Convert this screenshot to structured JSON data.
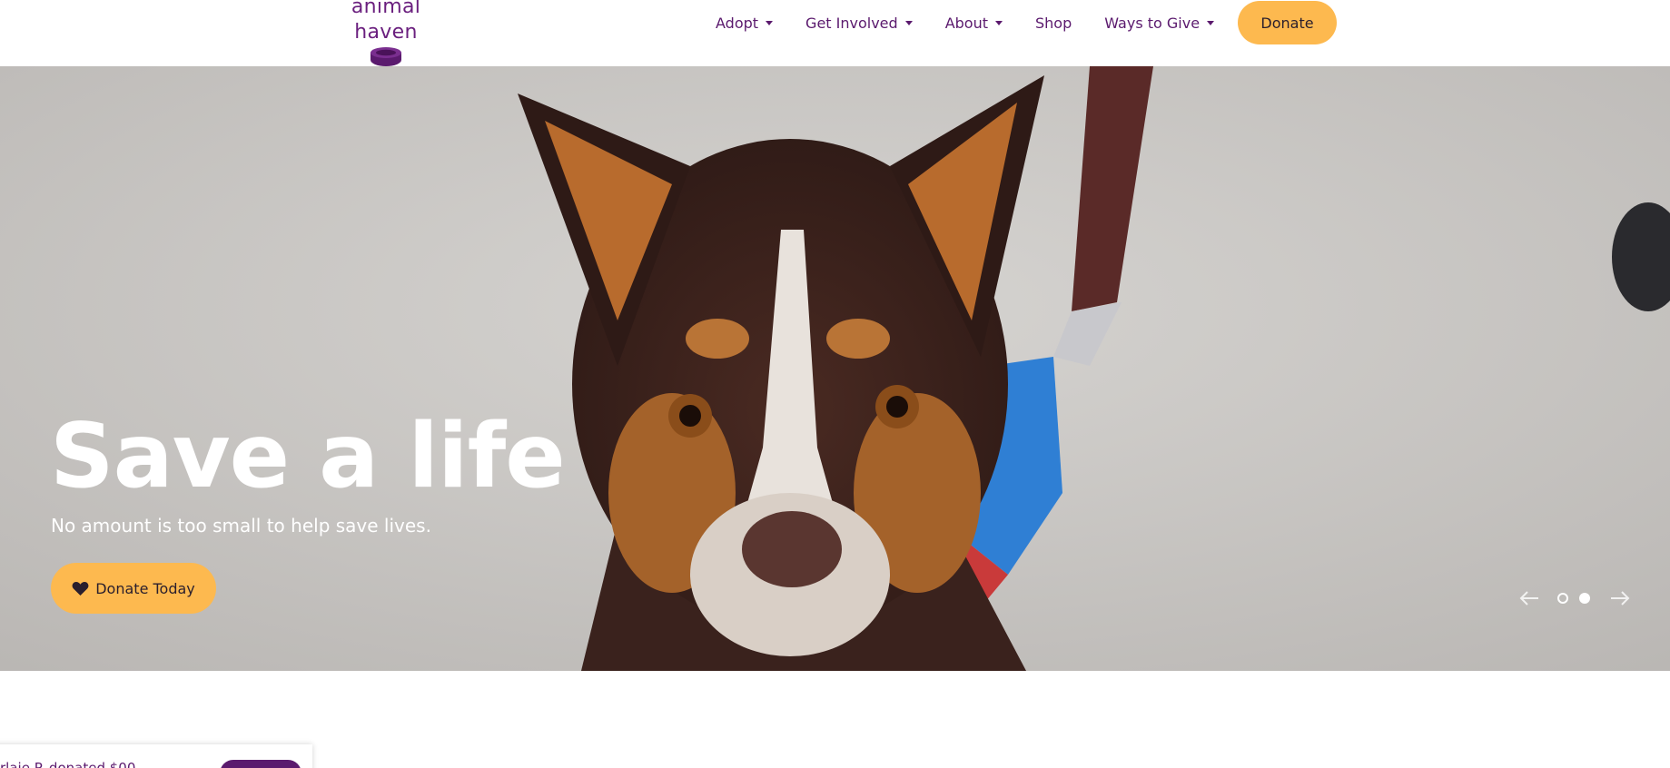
{
  "header": {
    "logo_text": "animal haven",
    "nav": [
      {
        "label": "Adopt",
        "has_dropdown": true
      },
      {
        "label": "Get Involved",
        "has_dropdown": true
      },
      {
        "label": "About",
        "has_dropdown": true
      },
      {
        "label": "Shop",
        "has_dropdown": false
      },
      {
        "label": "Ways to Give",
        "has_dropdown": true
      }
    ],
    "donate_label": "Donate"
  },
  "hero": {
    "title": "Save a life",
    "subtitle": "No amount is too small to help save lives.",
    "cta_label": "Donate Today",
    "cta_icon": "heart-icon",
    "slides_total": 2,
    "active_slide": 2
  },
  "notification": {
    "text": "rlaie P. donated $00"
  },
  "colors": {
    "brand_purple": "#5b1a6e",
    "accent_yellow": "#fdb94f",
    "hero_text": "#ffffff"
  }
}
